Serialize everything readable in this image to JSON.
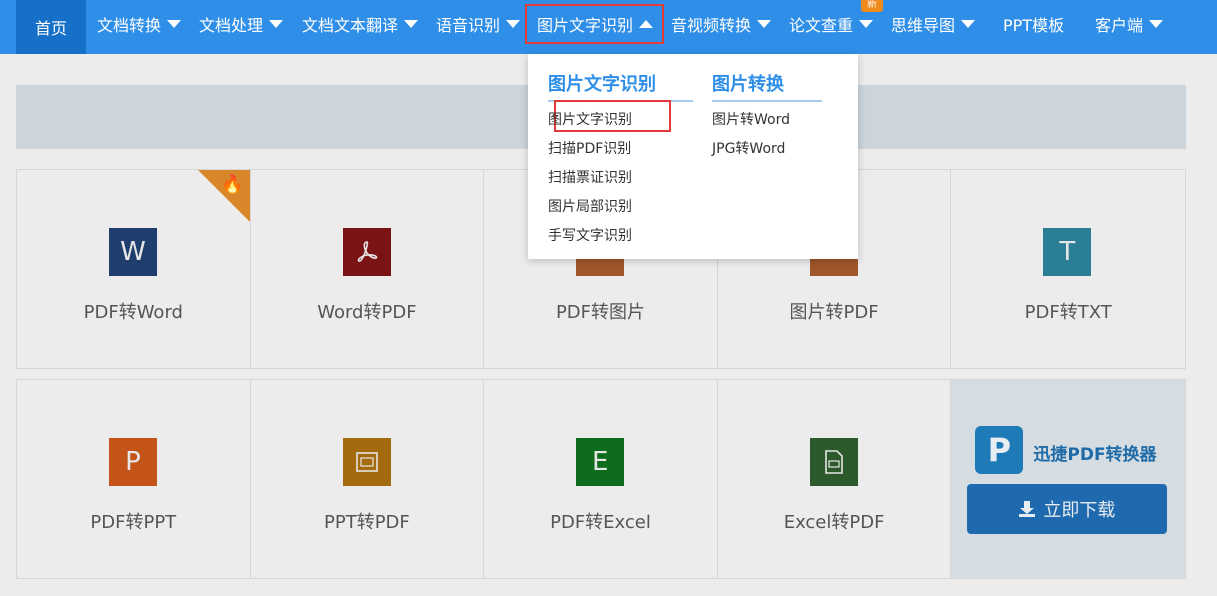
{
  "nav": {
    "items": [
      {
        "label": "首页",
        "caret": false
      },
      {
        "label": "文档转换",
        "caret": true
      },
      {
        "label": "文档处理",
        "caret": true
      },
      {
        "label": "文档文本翻译",
        "caret": true
      },
      {
        "label": "语音识别",
        "caret": true
      },
      {
        "label": "图片文字识别",
        "caret": true,
        "active": true
      },
      {
        "label": "音视频转换",
        "caret": true
      },
      {
        "label": "论文查重",
        "caret": true,
        "badge": "新"
      },
      {
        "label": "思维导图",
        "caret": true
      },
      {
        "label": "PPT模板",
        "caret": false
      },
      {
        "label": "客户端",
        "caret": true
      }
    ],
    "bg_color": "#2f8fe8"
  },
  "dropdown": {
    "col1": {
      "title": "图片文字识别",
      "items": [
        "图片文字识别",
        "扫描PDF识别",
        "扫描票证识别",
        "图片局部识别",
        "手写文字识别"
      ]
    },
    "col2": {
      "title": "图片转换",
      "items": [
        "图片转Word",
        "JPG转Word"
      ]
    }
  },
  "tools_row1": [
    {
      "label": "PDF转Word",
      "icon": "word-icon",
      "glyph": "W",
      "color": "#1f3e6e",
      "hot": true
    },
    {
      "label": "Word转PDF",
      "icon": "pdf-icon",
      "glyph": "⌁",
      "color": "#7a1414"
    },
    {
      "label": "PDF转图片",
      "icon": "image-icon",
      "glyph": "",
      "color": "#a0562a"
    },
    {
      "label": "图片转PDF",
      "icon": "image-pdf-icon",
      "glyph": "",
      "color": "#a0562a"
    },
    {
      "label": "PDF转TXT",
      "icon": "txt-icon",
      "glyph": "T",
      "color": "#2a7f97"
    }
  ],
  "tools_row2": [
    {
      "label": "PDF转PPT",
      "icon": "ppt-icon",
      "glyph": "P",
      "color": "#c45418"
    },
    {
      "label": "PPT转PDF",
      "icon": "ppt-pdf-icon",
      "glyph": "▤",
      "color": "#a46a0e"
    },
    {
      "label": "PDF转Excel",
      "icon": "excel-icon",
      "glyph": "E",
      "color": "#0e6d1d"
    },
    {
      "label": "Excel转PDF",
      "icon": "excel-pdf-icon",
      "glyph": "▤",
      "color": "#2c5a2c"
    }
  ],
  "promo": {
    "name": "迅捷PDF转换器",
    "logo_glyph": "P",
    "button": "立即下载"
  }
}
